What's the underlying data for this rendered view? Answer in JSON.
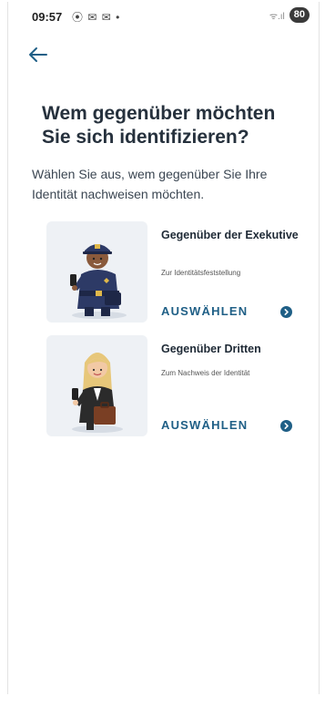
{
  "status_bar": {
    "time": "09:57",
    "icons": "⦿ ✉ ✉ •",
    "signal": "ᯤ.ıl",
    "battery": "80"
  },
  "header": {
    "back_icon": "arrow-left-icon"
  },
  "main": {
    "title": "Wem gegenüber möchten Sie sich identifizieren?",
    "subtitle": "Wählen Sie aus, wem gegenüber Sie Ihre Identität nachweisen möchten."
  },
  "options": [
    {
      "title": "Gegenüber der Exekutive",
      "description": "Zur Identitätsfeststellung",
      "action": "AUSWÄHLEN",
      "illustration": "police-officer-illustration"
    },
    {
      "title": "Gegenüber Dritten",
      "description": "Zum Nachweis der Identität",
      "action": "AUSWÄHLEN",
      "illustration": "woman-with-phone-illustration"
    }
  ],
  "nav_bar": {
    "recent_icon": "recent-apps-icon",
    "home_icon": "home-icon",
    "back_icon": "back-icon"
  },
  "colors": {
    "accent": "#1f5f86",
    "card_bg": "#eef1f5",
    "title_text": "#26313d"
  }
}
